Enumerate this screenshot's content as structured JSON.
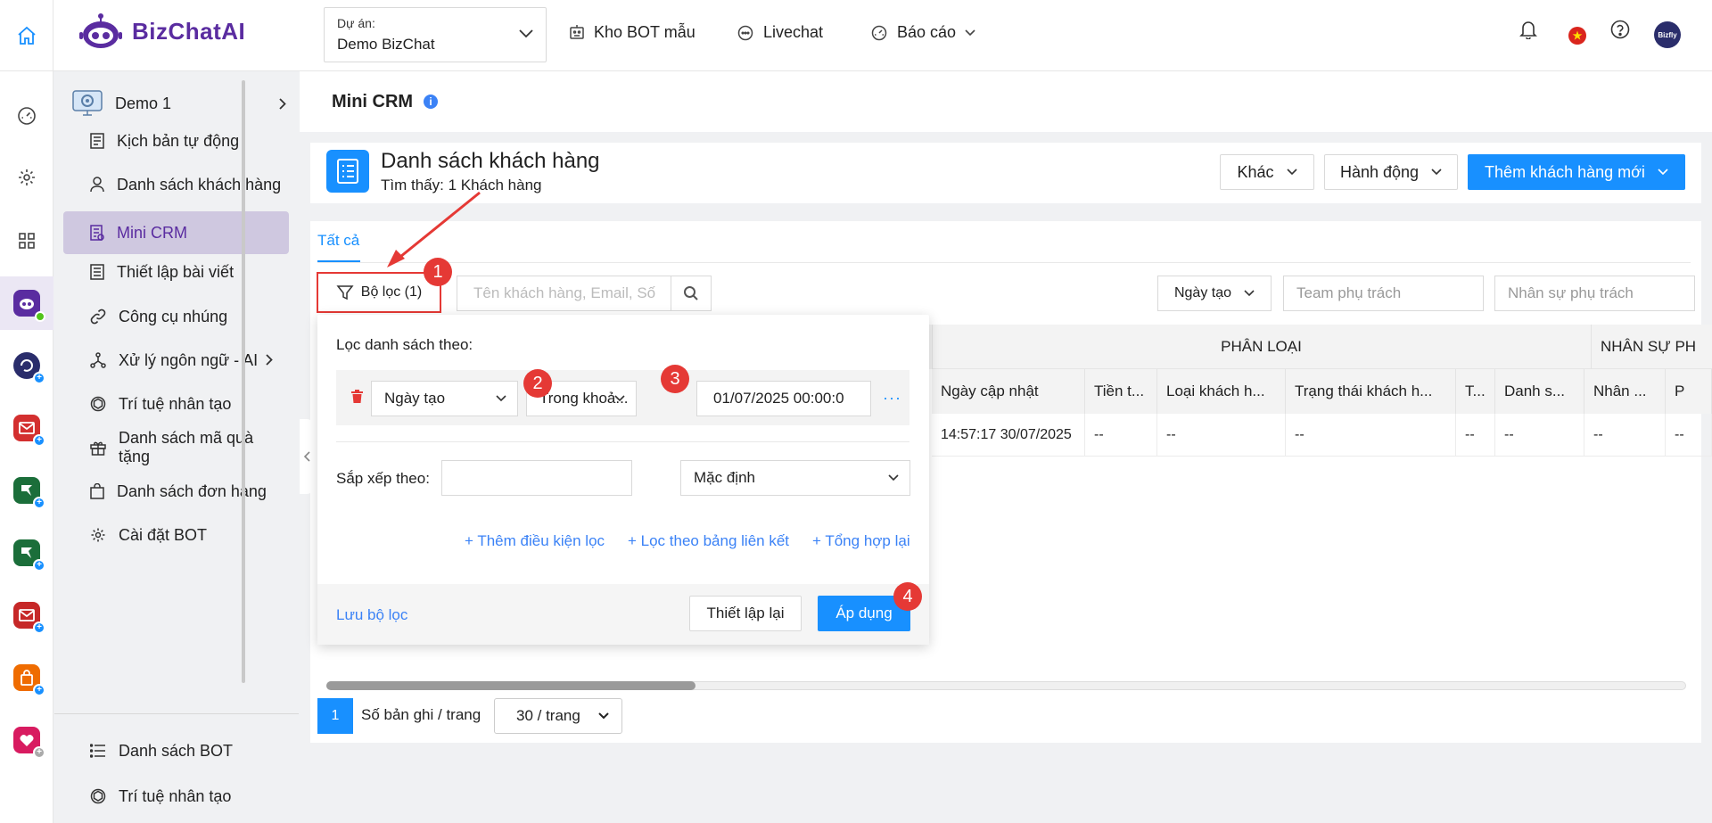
{
  "header": {
    "logo_text": "BizChatAI",
    "project_label": "Dự án:",
    "project_value": "Demo BizChat",
    "nav": [
      {
        "label": "Kho BOT mẫu",
        "icon": "robot-icon"
      },
      {
        "label": "Livechat",
        "icon": "chat-bubble-icon"
      },
      {
        "label": "Báo cáo",
        "icon": "dashboard-gauge-icon"
      }
    ],
    "avatar_text": "Bizfly"
  },
  "sidebar": {
    "bot_name": "Demo 1",
    "items": [
      {
        "label": "Kịch bản tự động",
        "icon": "script-list-icon"
      },
      {
        "label": "Danh sách khách hàng",
        "icon": "user-icon"
      },
      {
        "label": "Mini CRM",
        "icon": "crm-icon",
        "active": true
      },
      {
        "label": "Thiết lập bài viết",
        "icon": "document-icon"
      },
      {
        "label": "Công cụ nhúng",
        "icon": "link-icon"
      },
      {
        "label": "Xử lý ngôn ngữ - AI",
        "icon": "nlp-nodes-icon",
        "has_children": true
      },
      {
        "label": "Trí tuệ nhân tạo",
        "icon": "openai-icon"
      },
      {
        "label": "Danh sách mã quà tặng",
        "icon": "gift-icon"
      },
      {
        "label": "Danh sách đơn hàng",
        "icon": "shopping-bag-icon"
      },
      {
        "label": "Cài đặt BOT",
        "icon": "gear-icon"
      }
    ],
    "bottom_items": [
      {
        "label": "Danh sách BOT",
        "icon": "list-icon"
      },
      {
        "label": "Trí tuệ nhân tạo",
        "icon": "openai-icon"
      }
    ]
  },
  "page": {
    "title": "Mini CRM",
    "info_icon": "i",
    "list_title": "Danh sách khách hàng",
    "list_count": "Tìm thấy: 1 Khách hàng",
    "btn_other": "Khác",
    "btn_action": "Hành động",
    "btn_add": "Thêm khách hàng mới",
    "tab_all": "Tất cả"
  },
  "toolbar": {
    "filter_label": "Bộ lọc (1)",
    "search_placeholder": "Tên khách hàng, Email, Số",
    "created_label": "Ngày tạo",
    "team_placeholder": "Team phụ trách",
    "staff_placeholder": "Nhân sự phụ trách"
  },
  "table": {
    "group_headers": [
      "PHÂN LOẠI",
      "NHÂN SỰ PH"
    ],
    "columns": [
      "Ngày cập nhật",
      "Tiền t...",
      "Loại khách h...",
      "Trạng thái khách h...",
      "T...",
      "Danh s...",
      "Nhân ...",
      "P"
    ],
    "rows": [
      [
        "14:57:17 30/07/2025",
        "--",
        "--",
        "--",
        "--",
        "--",
        "--",
        "--"
      ]
    ]
  },
  "pagination": {
    "current_page": "1",
    "per_page_label": "Số bản ghi / trang",
    "per_page_value": "30 / trang"
  },
  "filter_popup": {
    "title": "Lọc danh sách theo:",
    "condition_field": "Ngày tạo",
    "condition_operator": "Trong khoả...",
    "condition_value": "01/07/2025 00:00:0",
    "more": "···",
    "sort_label": "Sắp xếp theo:",
    "sort_value": "Mặc định",
    "link_add_condition": "+ Thêm điều kiện lọc",
    "link_filter_linked": "+ Lọc theo bảng liên kết",
    "link_aggregate": "+ Tổng hợp lại",
    "save_filter": "Lưu bộ lọc",
    "reset": "Thiết lập lại",
    "apply": "Áp dụng"
  },
  "annotations": [
    "1",
    "2",
    "3",
    "4"
  ],
  "colors": {
    "primary": "#1890ff",
    "brand": "#5a2ca0",
    "annotation": "#e53935",
    "active_menu": "#cfc8e0"
  }
}
